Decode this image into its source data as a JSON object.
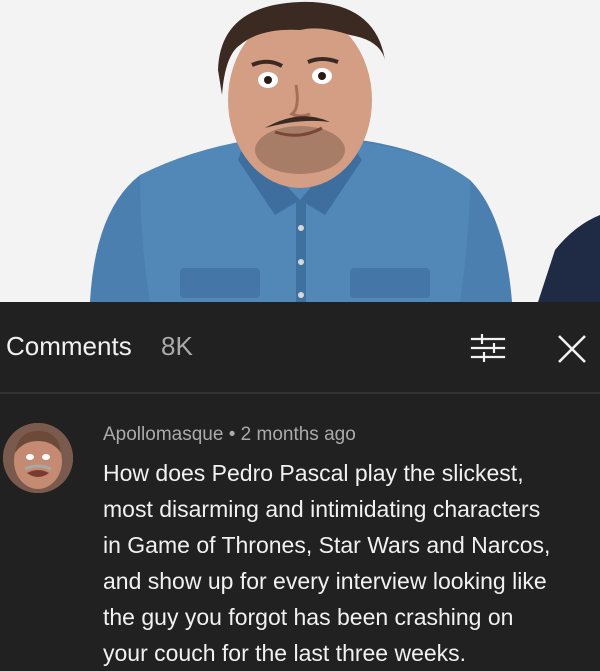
{
  "header": {
    "title": "Comments",
    "count": "8K",
    "icons": [
      "sort-filter-icon",
      "close-icon"
    ]
  },
  "comment": {
    "author": "Apollomasque",
    "separator": "•",
    "time": "2 months ago",
    "text": "How does Pedro Pascal play the slickest,\nmost disarming and intimidating characters\nin Game of Thrones, Star Wars and Narcos,\nand show up for every interview looking like\nthe guy you forgot has been crashing on\nyour couch for the last three weeks."
  },
  "colors": {
    "background": "#212121",
    "primary_text": "#f1f1f1",
    "secondary_text": "#aaaaaa",
    "shirt": "#4a7fb0"
  }
}
